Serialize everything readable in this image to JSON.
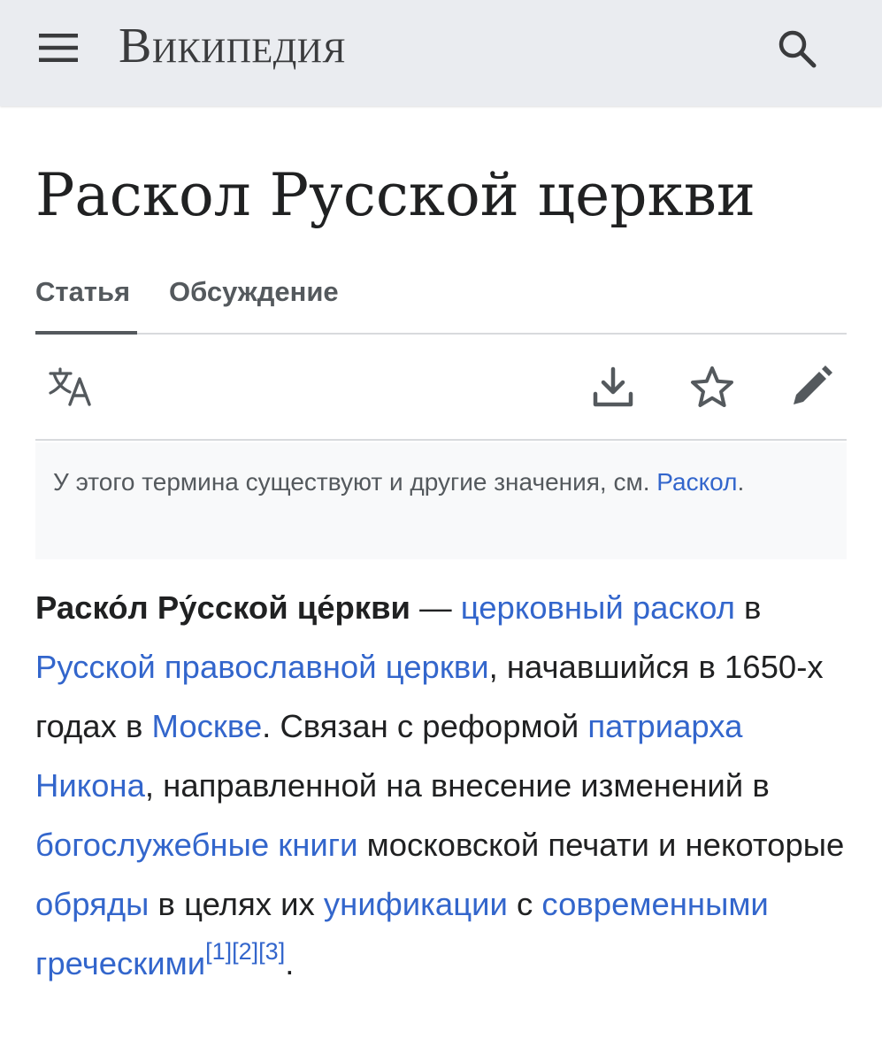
{
  "header": {
    "logo_text": "Википедия",
    "menu_icon": "hamburger-menu-icon",
    "search_icon": "search-icon",
    "background": "#eaecf0"
  },
  "page": {
    "title": "Раскол Русской церкви"
  },
  "tabs": [
    {
      "label": "Статья",
      "active": true
    },
    {
      "label": "Обсуждение",
      "active": false
    }
  ],
  "toolbar": {
    "language_icon": "translate-icon",
    "download_icon": "download-icon",
    "watch_icon": "star-icon",
    "edit_icon": "pencil-icon"
  },
  "hatnote": {
    "text": "У этого термина существуют и другие значения, см.",
    "link": "Раскол",
    "end": "."
  },
  "lead": {
    "bold_term": "Раско́л Ру́сской це́ркви",
    "dash": " — ",
    "link_1": "церковный раскол",
    "t1": " в ",
    "link_2": "Русской православной церкви",
    "t2": ", начавшийся в 1650-х годах в ",
    "link_3": "Москве",
    "t3": ". Связан с реформой ",
    "link_4": "патриарха Никона",
    "t4": ", направленной на внесение изменений в ",
    "link_5": "богослужебные книги",
    "t5": " московской печати и некоторые ",
    "link_6": "обряды",
    "t6": " в целях их ",
    "link_7": "унификации",
    "t7": " с ",
    "link_8": "современными греческими",
    "refs": [
      "[1]",
      "[2]",
      "[3]"
    ],
    "t8": "."
  },
  "colors": {
    "link": "#3366cc",
    "text": "#202122",
    "muted": "#54595d",
    "divider": "#d8dadd",
    "hatnote_bg": "#f8f9fa"
  }
}
